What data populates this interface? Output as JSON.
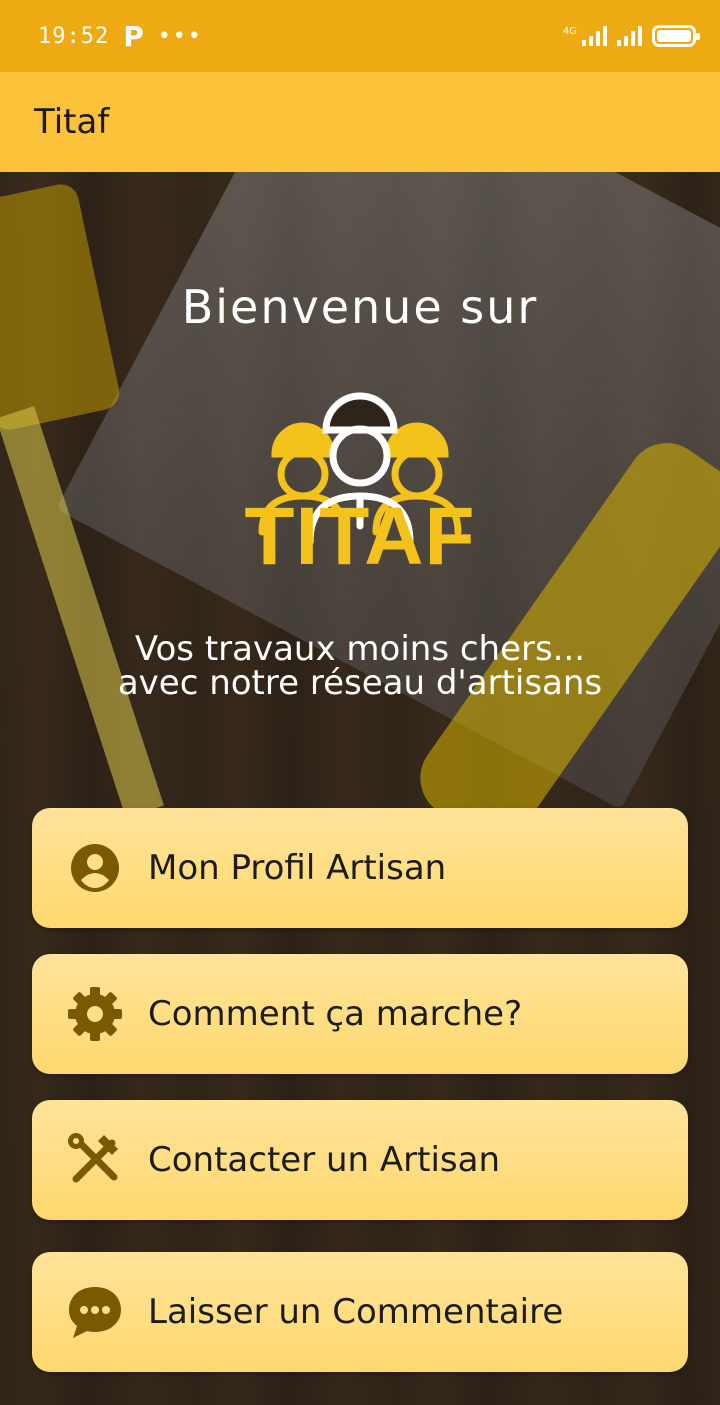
{
  "status_bar": {
    "time": "19:52",
    "app_indicator": "P",
    "more": "•••",
    "network": "4G"
  },
  "app_bar": {
    "title": "Titaf"
  },
  "hero": {
    "welcome": "Bienvenue sur",
    "logo_text": "TITAF",
    "tagline_line1": "Vos travaux moins chers...",
    "tagline_line2": "avec notre réseau d'artisans"
  },
  "menu": [
    {
      "label": "Mon Profil Artisan",
      "icon": "user-circle-icon"
    },
    {
      "label": "Comment ça marche?",
      "icon": "gear-icon"
    },
    {
      "label": "Contacter un Artisan",
      "icon": "tools-icon"
    },
    {
      "label": "Laisser un Commentaire",
      "icon": "chat-bubble-icon"
    }
  ],
  "colors": {
    "status_bar": "#eeaa12",
    "app_bar": "#fbc23a",
    "button": "#ffdf8a",
    "icon": "#7a5a00",
    "logo": "#f3c21b"
  }
}
